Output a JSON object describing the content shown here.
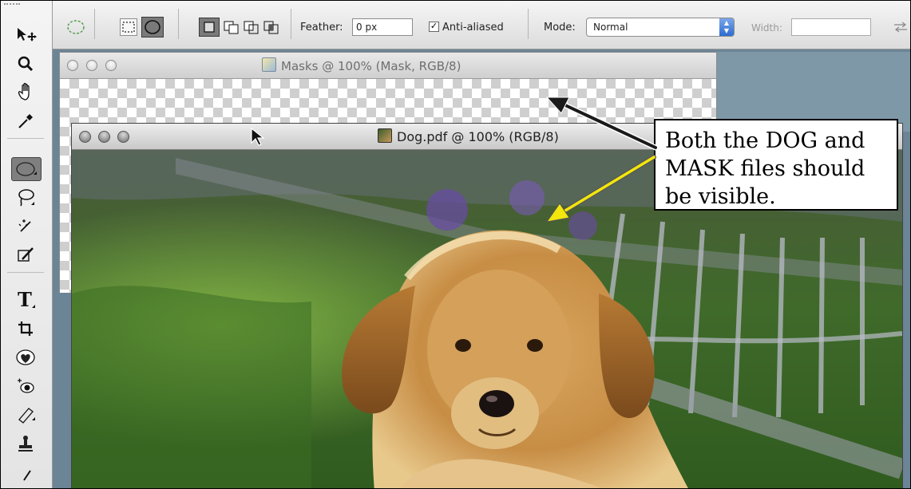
{
  "options_bar": {
    "feather_label": "Feather:",
    "feather_value": "0 px",
    "antialiased_label": "Anti-aliased",
    "antialiased_checked": true,
    "mode_label": "Mode:",
    "mode_value": "Normal",
    "width_label": "Width:",
    "width_value": ""
  },
  "masks_window": {
    "title": "Masks @ 100% (Mask, RGB/8)"
  },
  "dog_window": {
    "title": "Dog.pdf @ 100% (RGB/8)"
  },
  "callout": {
    "line1": "Both the DOG and",
    "line2": "MASK files should",
    "line3": "be visible."
  },
  "colors": {
    "arrow_black": "#1a1a1a",
    "arrow_yellow": "#f2e60c",
    "select_blue": "#2d6cd0"
  },
  "toolbox_icons": [
    "move-icon",
    "zoom-icon",
    "hand-icon",
    "eyedropper-icon",
    "elliptical-marquee-icon",
    "lasso-icon",
    "magic-wand-icon",
    "brush-icon",
    "type-icon",
    "crop-icon",
    "healing-brush-icon",
    "red-eye-icon",
    "bandage-icon",
    "clone-stamp-icon",
    "pen-icon"
  ]
}
